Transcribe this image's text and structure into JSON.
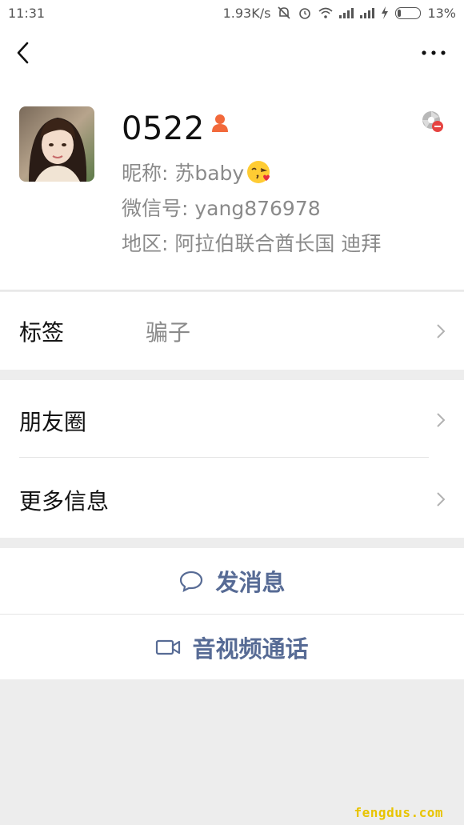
{
  "status_bar": {
    "time": "11:31",
    "network_speed": "1.93K/s",
    "battery_percent": "13%",
    "battery_level": 0.13
  },
  "nav": {
    "back_icon": "chevron-left-icon",
    "more_icon": "more-dots-icon"
  },
  "profile": {
    "display_name": "0522",
    "nickname_prefix": "昵称: 苏baby",
    "wechat_id": "微信号: yang876978",
    "region": "地区: 阿拉伯联合酋长国  迪拜",
    "badge_color": "#f2693b"
  },
  "tags_cell": {
    "title": "标签",
    "value": "骗子"
  },
  "moments_cell": {
    "title": "朋友圈"
  },
  "more_info_cell": {
    "title": "更多信息"
  },
  "actions": {
    "send_message": "发消息",
    "video_call": "音视频通话",
    "link_color": "#576b95"
  },
  "watermark": "fengdus.com"
}
